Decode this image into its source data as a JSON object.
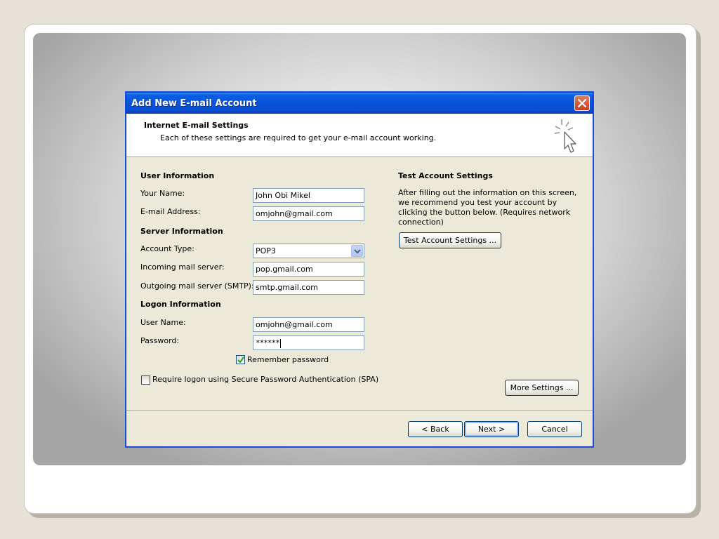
{
  "dialog": {
    "title": "Add New E-mail Account"
  },
  "header": {
    "title": "Internet E-mail Settings",
    "subtitle": "Each of these settings are required to get your e-mail account working."
  },
  "user_info": {
    "heading": "User Information",
    "your_name_label": "Your Name:",
    "your_name_value": "John Obi Mikel",
    "email_label": "E-mail Address:",
    "email_value": "omjohn@gmail.com"
  },
  "server_info": {
    "heading": "Server Information",
    "account_type_label": "Account Type:",
    "account_type_value": "POP3",
    "incoming_label": "Incoming mail server:",
    "incoming_value": "pop.gmail.com",
    "outgoing_label": "Outgoing mail server (SMTP):",
    "outgoing_value": "smtp.gmail.com"
  },
  "logon_info": {
    "heading": "Logon Information",
    "username_label": "User Name:",
    "username_value": "omjohn@gmail.com",
    "password_label": "Password:",
    "password_value": "******",
    "remember_label": "Remember password",
    "remember_checked": true,
    "spa_label": "Require logon using Secure Password Authentication (SPA)",
    "spa_checked": false
  },
  "test_settings": {
    "heading": "Test Account Settings",
    "description": "After filling out the information on this screen, we recommend you test your account by clicking the button below. (Requires network connection)",
    "test_button": "Test Account Settings ..."
  },
  "buttons": {
    "more_settings": "More Settings ...",
    "back": "< Back",
    "next": "Next >",
    "cancel": "Cancel"
  },
  "icons": {
    "close": "close-icon",
    "wizard": "cursor-sparkle-icon",
    "dropdown": "chevron-down-icon",
    "check": "checkmark-icon"
  },
  "colors": {
    "titlebar": "#0854d8",
    "dialog_bg": "#ece9d8",
    "input_border": "#7f9db9"
  }
}
